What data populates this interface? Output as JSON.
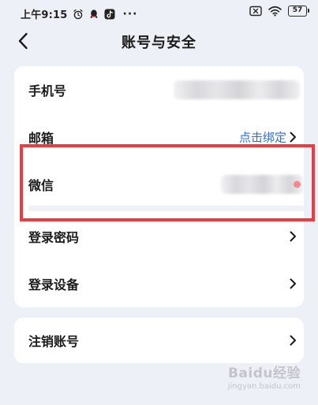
{
  "status_bar": {
    "time": "上午9:15",
    "battery_level": "57",
    "icons": [
      "alarm-icon",
      "qq-icon",
      "tiktok-icon",
      "more-dots-icon",
      "sim-off-icon",
      "wifi-icon",
      "battery-icon"
    ],
    "dots": "···"
  },
  "header": {
    "title": "账号与安全",
    "back_icon": "chevron-left-icon"
  },
  "main_card": {
    "rows": [
      {
        "label": "手机号",
        "value_state": "masked"
      },
      {
        "label": "邮箱",
        "action": "点击绑定",
        "chevron": true
      },
      {
        "label": "微信",
        "value_state": "masked"
      },
      {
        "label": "登录密码",
        "chevron": true
      },
      {
        "label": "登录设备",
        "chevron": true
      }
    ]
  },
  "cancel_card": {
    "label": "注销账号",
    "chevron": true
  },
  "annotation": {
    "highlight_color": "#f03a3f"
  },
  "watermark": {
    "main": "Baidu经验",
    "sub": "jingyan.baidu.com"
  },
  "colors": {
    "background": "#eef0f7",
    "card": "#ffffff",
    "link": "#2d6de6",
    "text": "#1b1b1b"
  }
}
